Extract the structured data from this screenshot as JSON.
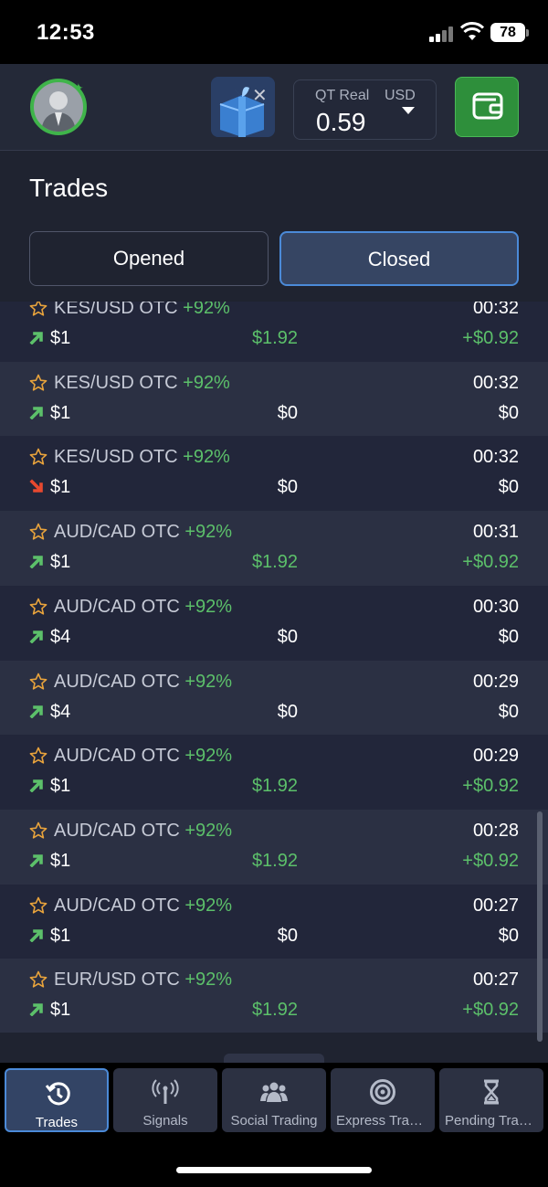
{
  "status_bar": {
    "time": "12:53",
    "battery": "78"
  },
  "header": {
    "account_type": "QT Real",
    "currency": "USD",
    "balance": "0.59",
    "close_glyph": "✕"
  },
  "trades": {
    "title": "Trades",
    "tabs": {
      "opened": "Opened",
      "closed": "Closed",
      "selected": "Closed"
    },
    "rows": [
      {
        "pair": "KES/USD OTC",
        "pct": "+92%",
        "time": "00:32",
        "direction": "up",
        "amount": "$1",
        "payout": "$1.92",
        "profit": "+$0.92",
        "win": true
      },
      {
        "pair": "KES/USD OTC",
        "pct": "+92%",
        "time": "00:32",
        "direction": "up",
        "amount": "$1",
        "payout": "$0",
        "profit": "$0",
        "win": false
      },
      {
        "pair": "KES/USD OTC",
        "pct": "+92%",
        "time": "00:32",
        "direction": "down",
        "amount": "$1",
        "payout": "$0",
        "profit": "$0",
        "win": false
      },
      {
        "pair": "AUD/CAD OTC",
        "pct": "+92%",
        "time": "00:31",
        "direction": "up",
        "amount": "$1",
        "payout": "$1.92",
        "profit": "+$0.92",
        "win": true
      },
      {
        "pair": "AUD/CAD OTC",
        "pct": "+92%",
        "time": "00:30",
        "direction": "up",
        "amount": "$4",
        "payout": "$0",
        "profit": "$0",
        "win": false
      },
      {
        "pair": "AUD/CAD OTC",
        "pct": "+92%",
        "time": "00:29",
        "direction": "up",
        "amount": "$4",
        "payout": "$0",
        "profit": "$0",
        "win": false
      },
      {
        "pair": "AUD/CAD OTC",
        "pct": "+92%",
        "time": "00:29",
        "direction": "up",
        "amount": "$1",
        "payout": "$1.92",
        "profit": "+$0.92",
        "win": true
      },
      {
        "pair": "AUD/CAD OTC",
        "pct": "+92%",
        "time": "00:28",
        "direction": "up",
        "amount": "$1",
        "payout": "$1.92",
        "profit": "+$0.92",
        "win": true
      },
      {
        "pair": "AUD/CAD OTC",
        "pct": "+92%",
        "time": "00:27",
        "direction": "up",
        "amount": "$1",
        "payout": "$0",
        "profit": "$0",
        "win": false
      },
      {
        "pair": "EUR/USD OTC",
        "pct": "+92%",
        "time": "00:27",
        "direction": "up",
        "amount": "$1",
        "payout": "$1.92",
        "profit": "+$0.92",
        "win": true
      }
    ]
  },
  "bottom_nav": [
    {
      "label": "Trades",
      "icon": "history-icon",
      "active": true
    },
    {
      "label": "Signals",
      "icon": "antenna-icon",
      "active": false
    },
    {
      "label": "Social Trading",
      "icon": "people-icon",
      "active": false
    },
    {
      "label": "Express Trades",
      "icon": "target-icon",
      "active": false
    },
    {
      "label": "Pending Trades",
      "icon": "hourglass-icon",
      "active": false
    }
  ],
  "colors": {
    "accent": "#4b8ad8",
    "profit": "#5cc06a",
    "loss_arrow": "#e8492f",
    "star": "#e8a33c"
  }
}
